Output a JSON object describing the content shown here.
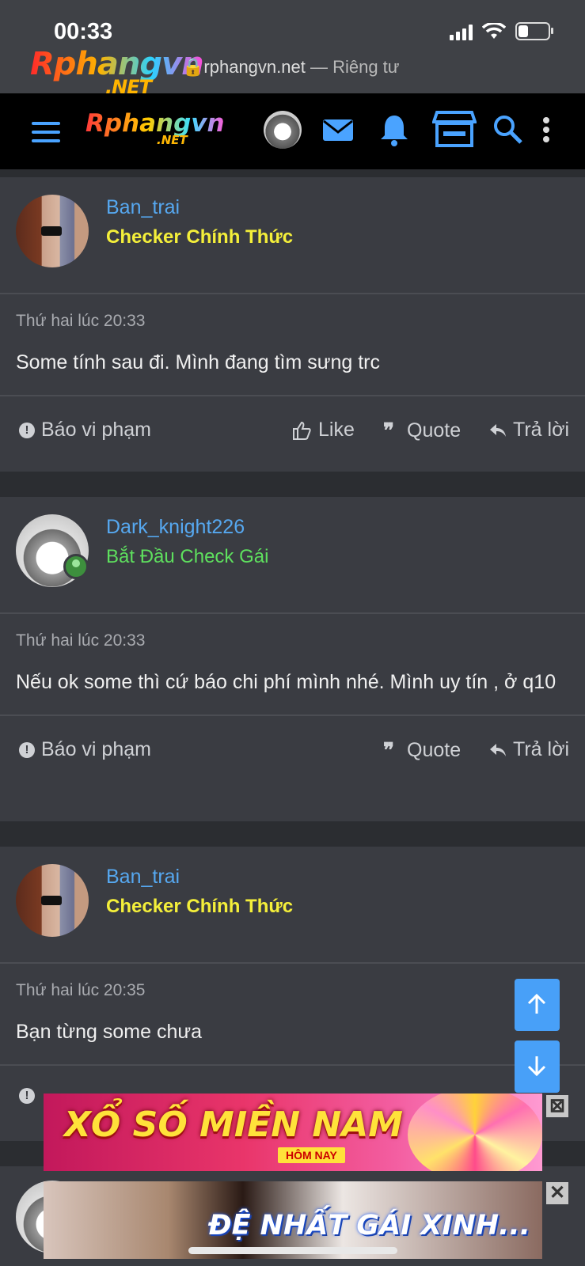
{
  "status": {
    "time": "00:33"
  },
  "browser": {
    "url": "rphangvn.net",
    "url_suffix": " — Riêng tư"
  },
  "brand": {
    "logo": "Rphangvn",
    "logo_suffix": ".NET"
  },
  "posts": [
    {
      "username": "Ban_trai",
      "user_title": "Checker Chính Thức",
      "date": "Thứ hai lúc 20:33",
      "text": "Some tính sau đi. Mình đang tìm sưng trc",
      "actions": {
        "report": "Báo vi phạm",
        "like": "Like",
        "quote": "Quote",
        "reply": "Trả lời"
      }
    },
    {
      "username": "Dark_knight226",
      "user_title": "Bắt Đầu Check Gái",
      "date": "Thứ hai lúc 20:33",
      "text": "Nếu ok some thì cứ báo chi phí mình nhé. Mình uy tín , ở q10",
      "actions": {
        "report": "Báo vi phạm",
        "quote": "Quote",
        "reply": "Trả lời"
      }
    },
    {
      "username": "Ban_trai",
      "user_title": "Checker Chính Thức",
      "date": "Thứ hai lúc 20:35",
      "text": "Bạn từng some chưa"
    }
  ],
  "ads": [
    {
      "headline": "XỔ SỐ MIỀN NAM",
      "sub": "HÔM NAY"
    },
    {
      "headline": "ĐỆ NHẤT GÁI XINH..."
    }
  ],
  "icons": {
    "menu": "hamburger-icon",
    "messages": "envelope-icon",
    "alerts": "bell-icon",
    "store": "store-icon",
    "search": "search-icon",
    "more": "more-vertical-icon"
  },
  "colors": {
    "accent": "#4aa3ff",
    "username": "#56a8f0",
    "title_yellow": "#f4ef3a",
    "title_green": "#5ee05e"
  }
}
